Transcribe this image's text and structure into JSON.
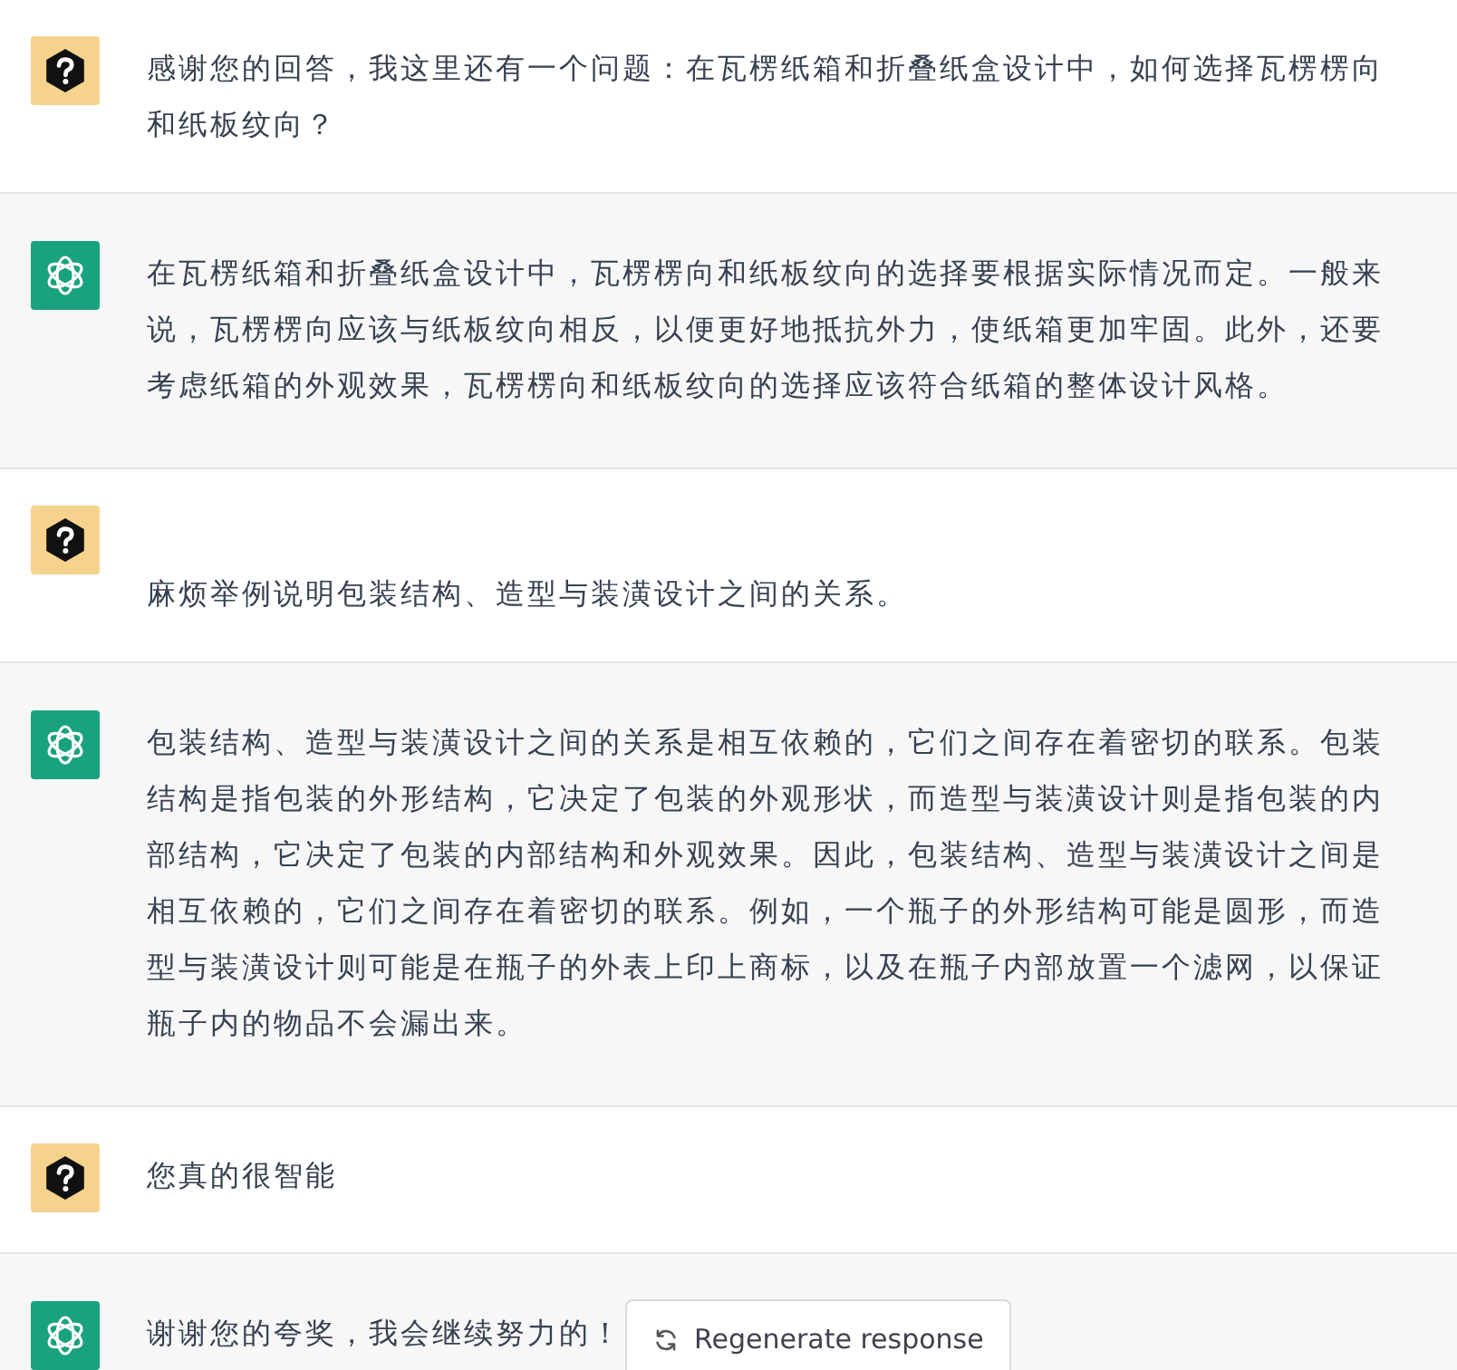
{
  "messages": [
    {
      "kind": "user",
      "text": "感谢您的回答，我这里还有一个问题：在瓦楞纸箱和折叠纸盒设计中，如何选择瓦楞楞向和纸板纹向？"
    },
    {
      "kind": "assistant",
      "text": "在瓦楞纸箱和折叠纸盒设计中，瓦楞楞向和纸板纹向的选择要根据实际情况而定。一般来说，瓦楞楞向应该与纸板纹向相反，以便更好地抵抗外力，使纸箱更加牢固。此外，还要考虑纸箱的外观效果，瓦楞楞向和纸板纹向的选择应该符合纸箱的整体设计风格。"
    },
    {
      "kind": "user",
      "text": "\n麻烦举例说明包装结构、造型与装潢设计之间的关系。"
    },
    {
      "kind": "assistant",
      "text": "包装结构、造型与装潢设计之间的关系是相互依赖的，它们之间存在着密切的联系。包装结构是指包装的外形结构，它决定了包装的外观形状，而造型与装潢设计则是指包装的内部结构，它决定了包装的内部结构和外观效果。因此，包装结构、造型与装潢设计之间是相互依赖的，它们之间存在着密切的联系。例如，一个瓶子的外形结构可能是圆形，而造型与装潢设计则可能是在瓶子的外表上印上商标，以及在瓶子内部放置一个滤网，以保证瓶子内的物品不会漏出来。"
    },
    {
      "kind": "user",
      "text": "您真的很智能"
    },
    {
      "kind": "assistant",
      "text": "谢谢您的夸奖，我会继续努力的！"
    }
  ],
  "regenerate_button": {
    "label": "Regenerate response"
  }
}
